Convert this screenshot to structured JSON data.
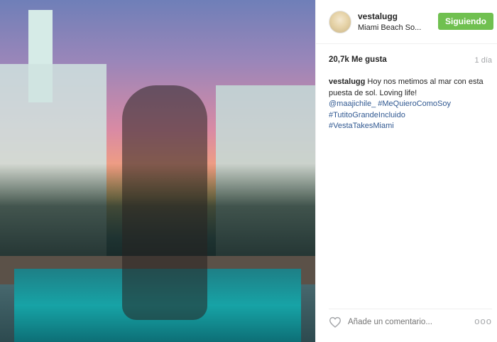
{
  "post": {
    "photo": {
      "alt": ""
    },
    "header": {
      "username": "vestalugg",
      "location": "Miami Beach So...",
      "follow_label": "Siguiendo"
    },
    "stats": {
      "likes": "20,7k Me gusta",
      "time": "1 día"
    },
    "caption": {
      "author": "vestalugg",
      "text": "Hoy nos metimos al mar con esta puesta de sol. Loving life!",
      "tags": [
        "@maajichile_",
        "#MeQuieroComoSoy",
        "#TutitoGrandeIncluido",
        "#VestaTakesMiami"
      ]
    },
    "comment": {
      "placeholder": "Añade un comentario...",
      "more_label": "ooo"
    },
    "colors": {
      "follow_button": "#70c050",
      "link": "#305891",
      "muted": "#a5a7aa"
    },
    "icons": [
      "heart-icon",
      "more-options-icon"
    ]
  }
}
